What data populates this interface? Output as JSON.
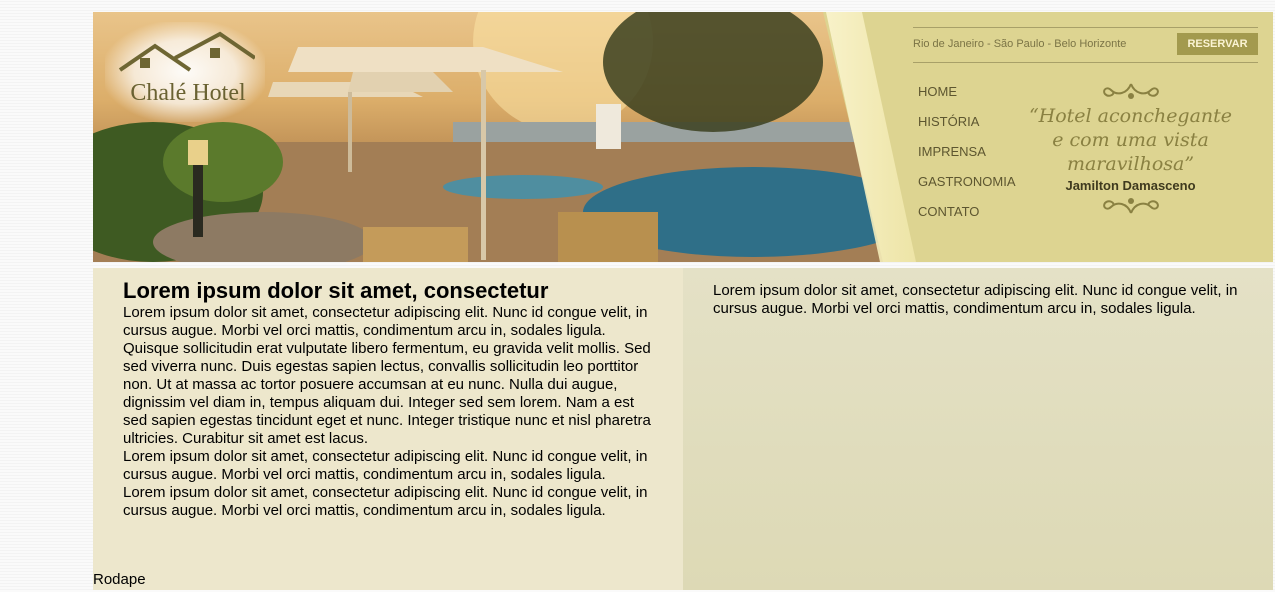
{
  "header": {
    "logo_text": "Chalé Hotel",
    "cities": "Rio de Janeiro - São Paulo - Belo Horizonte",
    "reserve_label": "RESERVAR",
    "nav": [
      "HOME",
      "HISTÓRIA",
      "IMPRENSA",
      "GASTRONOMIA",
      "CONTATO"
    ],
    "quote_lines": [
      "“Hotel aconchegante",
      "e com uma vista",
      "maravilhosa”"
    ],
    "quote_author": "Jamilton Damasceno",
    "colors": {
      "panel": "#ddd491",
      "button": "#a39a4e",
      "text": "#5d5630"
    }
  },
  "main": {
    "title": "Lorem ipsum dolor sit amet, consectetur",
    "paragraphs": [
      "Lorem ipsum dolor sit amet, consectetur adipiscing elit. Nunc id congue velit, in cursus augue. Morbi vel orci mattis, condimentum arcu in, sodales ligula. Quisque sollicitudin erat vulputate libero fermentum, eu gravida velit mollis. Sed sed viverra nunc. Duis egestas sapien lectus, convallis sollicitudin leo porttitor non. Ut at massa ac tortor posuere accumsan at eu nunc. Nulla dui augue, dignissim vel diam in, tempus aliquam dui. Integer sed sem lorem. Nam a est sed sapien egestas tincidunt eget et nunc. Integer tristique nunc et nisl pharetra ultricies. Curabitur sit amet est lacus.",
      "Lorem ipsum dolor sit amet, consectetur adipiscing elit. Nunc id congue velit, in cursus augue. Morbi vel orci mattis, condimentum arcu in, sodales ligula.",
      "Lorem ipsum dolor sit amet, consectetur adipiscing elit. Nunc id congue velit, in cursus augue. Morbi vel orci mattis, condimentum arcu in, sodales ligula."
    ]
  },
  "aside": {
    "text": "Lorem ipsum dolor sit amet, consectetur adipiscing elit. Nunc id congue velit, in cursus augue. Morbi vel orci mattis, condimentum arcu in, sodales ligula."
  },
  "footer": {
    "text": "Rodape"
  }
}
